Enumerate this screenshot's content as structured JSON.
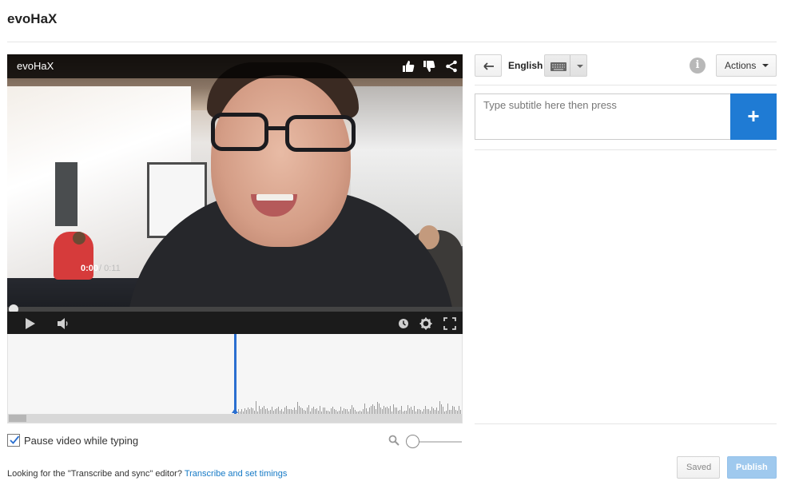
{
  "page": {
    "title": "evoHaX"
  },
  "player": {
    "title": "evoHaX",
    "time_current": "0:00",
    "time_total": " / 0:11",
    "progress": 0,
    "top_icons": [
      "thumbs-up-icon",
      "thumbs-down-icon",
      "share-icon"
    ],
    "control_icons": [
      "play-icon",
      "volume-icon",
      "watch-later-icon",
      "settings-icon",
      "fullscreen-icon"
    ]
  },
  "editor": {
    "pause_label": "Pause video while typing",
    "pause_checked": true,
    "footer_prefix": "Looking for the \"Transcribe and sync\" editor? ",
    "footer_link": "Transcribe and set timings"
  },
  "panel": {
    "language": "English",
    "actions_label": "Actions",
    "subtitle_placeholder": "Type subtitle here then press",
    "add_symbol": "+",
    "info_symbol": "i",
    "saved_label": "Saved",
    "publish_label": "Publish"
  },
  "colors": {
    "accent": "#1f7bd4",
    "publish_disabled": "#9fc9ee",
    "link": "#167ac6",
    "wave_cursor": "#2a6fd0"
  }
}
